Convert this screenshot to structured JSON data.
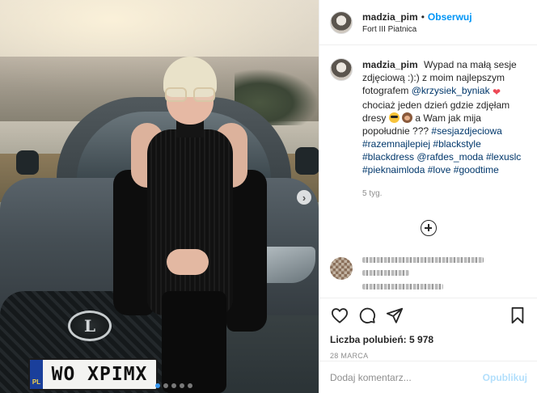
{
  "post": {
    "plate_text": "WO XPIMX",
    "plate_country": "PL",
    "photo_index": 1,
    "photo_count": 5
  },
  "header": {
    "username": "madzia_pim",
    "separator": "•",
    "follow_label": "Obserwuj",
    "location": "Fort III Piatnica"
  },
  "caption": {
    "username": "madzia_pim",
    "text_1": "Wypad na małą sesje zdjęciową :):) z moim najlepszym fotografem",
    "mention_1": "@krzysiek_byniak",
    "text_2": "chociaż jeden dzień gdzie zdjęłam dresy",
    "text_3": "a Wam jak mija popołudnie ???",
    "hashtag_1": "#sesjazdjeciowa",
    "hashtag_2": "#razemnajlepiej",
    "hashtag_3": "#blackstyle",
    "hashtag_4": "#blackdress",
    "mention_2": "@rafdes_moda",
    "hashtag_5": "#lexuslc",
    "hashtag_6": "#pieknaimloda",
    "hashtag_7": "#love",
    "hashtag_8": "#goodtime",
    "time": "5 tyg."
  },
  "icons": {
    "heart": "heart-icon",
    "comment": "comment-icon",
    "share": "share-icon",
    "save": "bookmark-icon",
    "load_more": "plus-circle-icon",
    "next": "chevron-right-icon"
  },
  "engagement": {
    "likes_label": "Liczba polubień:",
    "likes_count": "5 978",
    "date": "28 MARCA"
  },
  "composer": {
    "placeholder": "Dodaj komentarz...",
    "publish_label": "Opublikuj"
  },
  "colors": {
    "accent": "#0095f6",
    "publish_disabled": "#b2dffc",
    "link": "#00376b",
    "heart": "#ed4956"
  }
}
